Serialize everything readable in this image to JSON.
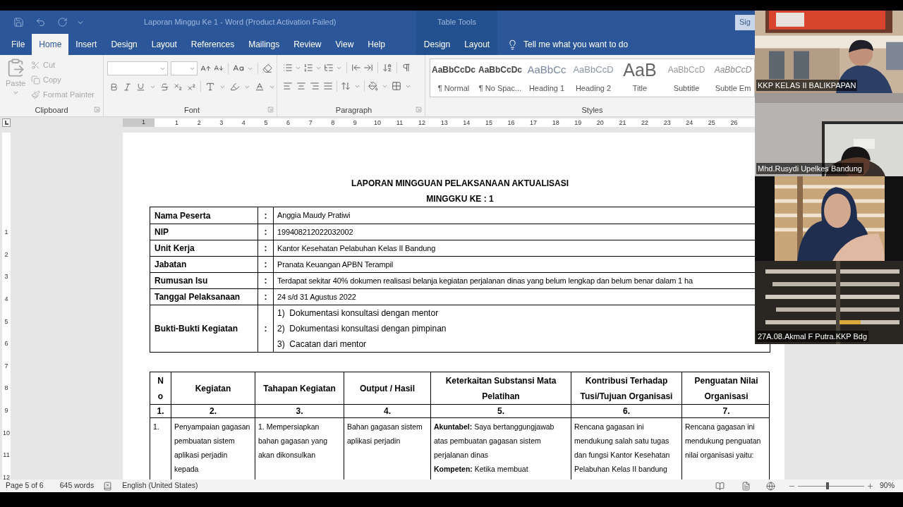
{
  "title_bar": {
    "title": "Laporan Minggu Ke 1  -  Word (Product Activation Failed)",
    "table_tools": "Table Tools",
    "sign_in": "Sig"
  },
  "tabs": [
    {
      "label": "File",
      "selected": false
    },
    {
      "label": "Home",
      "selected": true
    },
    {
      "label": "Insert",
      "selected": false
    },
    {
      "label": "Design",
      "selected": false
    },
    {
      "label": "Layout",
      "selected": false
    },
    {
      "label": "References",
      "selected": false
    },
    {
      "label": "Mailings",
      "selected": false
    },
    {
      "label": "Review",
      "selected": false
    },
    {
      "label": "View",
      "selected": false
    },
    {
      "label": "Help",
      "selected": false
    }
  ],
  "table_tools_tabs": [
    {
      "label": "Design",
      "selected": false
    },
    {
      "label": "Layout",
      "selected": false
    }
  ],
  "tell_me": "Tell me what you want to do",
  "ribbon": {
    "clipboard": {
      "group": "Clipboard",
      "paste": {
        "label": "Paste",
        "disabled": true
      },
      "items": [
        {
          "label": "Cut",
          "disabled": true
        },
        {
          "label": "Copy",
          "disabled": true
        },
        {
          "label": "Format Painter",
          "disabled": true
        }
      ]
    },
    "font": {
      "group": "Font"
    },
    "paragraph": {
      "group": "Paragraph"
    },
    "styles": {
      "group": "Styles",
      "items": [
        {
          "preview": "AaBbCcDc",
          "label": "¶ Normal",
          "kind": "normal"
        },
        {
          "preview": "AaBbCcDc",
          "label": "¶ No Spac...",
          "kind": "normal"
        },
        {
          "preview": "AaBbCc",
          "label": "Heading 1",
          "kind": "heading1"
        },
        {
          "preview": "AaBbCcD",
          "label": "Heading 2",
          "kind": "heading2"
        },
        {
          "preview": "AaB",
          "label": "Title",
          "kind": "title"
        },
        {
          "preview": "AaBbCcD",
          "label": "Subtitle",
          "kind": "subtitle"
        },
        {
          "preview": "AaBbCcD",
          "label": "Subtle Em",
          "kind": "emphasis"
        }
      ]
    }
  },
  "ruler": {
    "left_mark": "1",
    "marks": [
      "1",
      "2",
      "3",
      "4",
      "5",
      "6",
      "7",
      "8",
      "9",
      "10",
      "11",
      "12",
      "13",
      "14",
      "15",
      "16",
      "17",
      "18",
      "19",
      "20",
      "21",
      "22",
      "23",
      "24",
      "25",
      "26"
    ]
  },
  "vertical_ruler": {
    "marks": [
      "1",
      "2",
      "3",
      "4",
      "5",
      "6",
      "7",
      "8",
      "9",
      "10",
      "11",
      "12"
    ]
  },
  "document": {
    "title": "LAPORAN MINGGUAN PELAKSANAAN AKTUALISASI",
    "subtitle": "MINGGKU KE : 1",
    "info_rows": [
      {
        "kind": "text",
        "label": "Nama Peserta",
        "separator": ":",
        "value": "Anggia Maudy Pratiwi"
      },
      {
        "kind": "text",
        "label": "NIP",
        "separator": ":",
        "value": "199408212022032002"
      },
      {
        "kind": "text",
        "label": "Unit  Kerja",
        "separator": ":",
        "value": "Kantor Kesehatan Pelabuhan Kelas II Bandung"
      },
      {
        "kind": "text",
        "label": "Jabatan",
        "separator": ":",
        "value": "Pranata Keuangan APBN Terampil"
      },
      {
        "kind": "text",
        "label": "Rumusan Isu",
        "separator": ":",
        "value": "Terdapat sekitar 40% dokumen realisasi belanja kegiatan perjalanan dinas yang belum lengkap dan belum benar dalam 1 ha"
      },
      {
        "kind": "text",
        "label": "Tanggal Pelaksanaan",
        "separator": ":",
        "value": "24 s/d 31 Agustus 2022"
      },
      {
        "kind": "list",
        "label": "Bukti-Bukti Kegiatan",
        "separator": ":",
        "items": [
          "1)  Dokumentasi konsultasi dengan mentor",
          "2)  Dokumentasi konsultasi dengan pimpinan",
          "3)  Cacatan dari mentor"
        ]
      }
    ],
    "activity_table": {
      "columns": [
        "No",
        "Kegiatan",
        "Tahapan Kegiatan",
        "Output / Hasil",
        "Keterkaitan Substansi Mata Pelatihan",
        "Kontribusi Terhadap Tusi/Tujuan Organisasi",
        "Penguatan Nilai Organisasi"
      ],
      "column_numbers": [
        "1.",
        "2.",
        "3.",
        "4.",
        "5.",
        "6.",
        "7."
      ],
      "rows": [
        {
          "cells": [
            [
              "1."
            ],
            [
              "Penyampaian gagasan pembuatan sistem aplikasi perjadin kepada"
            ],
            [
              "1. Mempersiapkan bahan gagasan yang akan dikonsulkan"
            ],
            [
              "Bahan gagasan sistem aplikasi perjadin"
            ],
            [
              "**Akuntabel:** Saya bertanggungjawab atas pembuatan gagasan sistem perjalanan dinas",
              "**Kompeten:** Ketika membuat"
            ],
            [
              "Rencana gagasan ini mendukung salah satu tugas dan fungsi Kantor Kesehatan Pelabuhan Kelas II bandung"
            ],
            [
              "Rencana gagasan ini mendukung penguatan nilai organisasi yaitu:"
            ]
          ]
        }
      ]
    }
  },
  "status_bar": {
    "page": "Page 5 of 6",
    "words": "645 words",
    "language": "English (United States)",
    "zoom": {
      "level": 0.45,
      "reading": "90%"
    }
  },
  "videos": [
    {
      "kind": "picture",
      "name": "KKP KELAS II BALIKPAPAN"
    },
    {
      "kind": "picture",
      "name": "Mhd.Rusydi Upelkes Bandung"
    },
    {
      "kind": "picture"
    },
    {
      "kind": "picture",
      "name": "27A.08.Akmal F Putra.KKP Bdg"
    }
  ]
}
